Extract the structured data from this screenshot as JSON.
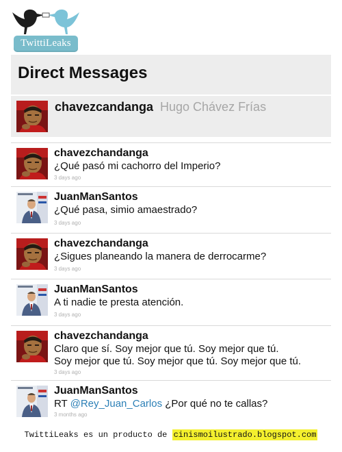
{
  "logo": {
    "text": "TwittiLeaks"
  },
  "header": {
    "title": "Direct Messages"
  },
  "profile": {
    "username": "chavezcandanga",
    "display_name": "Hugo Chávez Frías",
    "avatar": "chavez-avatar"
  },
  "messages": [
    {
      "username": "chavezchandanga",
      "text": "¿Qué pasó mi cachorro del Imperio?",
      "time": "3 days ago",
      "avatar": "chavez-avatar"
    },
    {
      "username": "JuanManSantos",
      "text": "¿Qué pasa, simio amaestrado?",
      "time": "3 days ago",
      "avatar": "santos-avatar"
    },
    {
      "username": "chavezchandanga",
      "text": "¿Sigues planeando la manera de derrocarme?",
      "time": "3 days ago",
      "avatar": "chavez-avatar"
    },
    {
      "username": "JuanManSantos",
      "text": "A ti nadie te presta atención.",
      "time": "3 days ago",
      "avatar": "santos-avatar"
    },
    {
      "username": "chavezchandanga",
      "text_line1": "Claro que sí. Soy mejor que tú. Soy mejor que tú.",
      "text_line2": "Soy mejor que tú. Soy mejor que tú. Soy mejor que tú.",
      "time": "3 days ago",
      "avatar": "chavez-avatar"
    },
    {
      "username": "JuanManSantos",
      "text_prefix": "RT ",
      "mention": "@Rey_Juan_Carlos",
      "text_suffix": " ¿Por qué no te callas?",
      "time": "3 months ago",
      "avatar": "santos-avatar"
    }
  ],
  "footer": {
    "text": "TwittiLeaks es un producto de",
    "link": "cinismoilustrado.blogspot.com"
  },
  "colors": {
    "header_bg": "#ededed",
    "mention": "#2b7fb6",
    "logo_badge": "#79bccb",
    "footer_highlight": "#f4f02e"
  }
}
